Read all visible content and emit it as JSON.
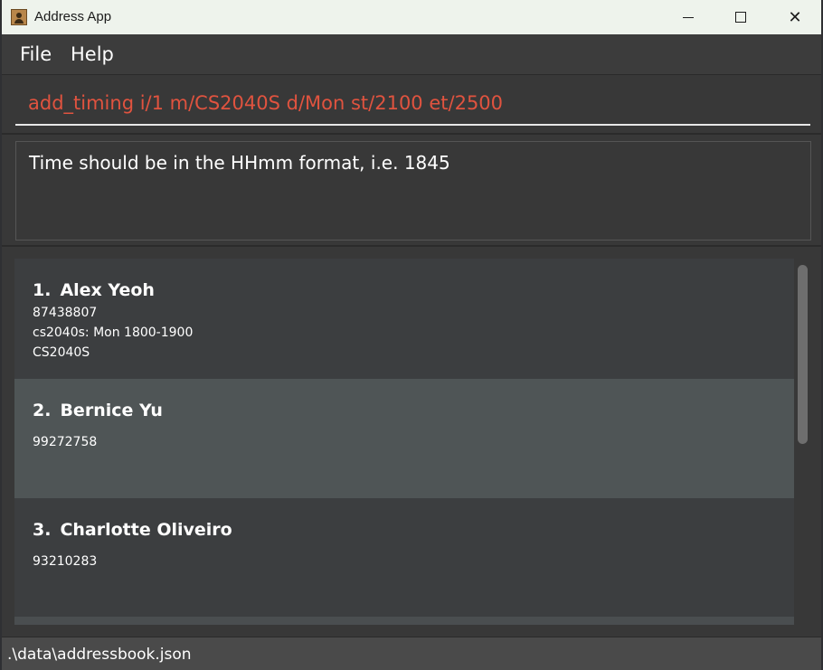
{
  "window": {
    "title": "Address App"
  },
  "menu": {
    "items": [
      "File",
      "Help"
    ]
  },
  "command": {
    "value": "add_timing i/1 m/CS2040S d/Mon st/2100 et/2500"
  },
  "result": {
    "message": "Time should be in the HHmm format, i.e. 1845"
  },
  "persons": [
    {
      "index": "1.",
      "name": "Alex Yeoh",
      "phone": "87438807",
      "timing": "cs2040s: Mon 1800-1900",
      "module": "CS2040S"
    },
    {
      "index": "2.",
      "name": "Bernice Yu",
      "phone": "99272758"
    },
    {
      "index": "3.",
      "name": "Charlotte Oliveiro",
      "phone": "93210283"
    }
  ],
  "status": {
    "path": ".\\data\\addressbook.json"
  },
  "colors": {
    "command_text": "#e0533f",
    "selected_card": "#4f5556",
    "card": "#3c3e40",
    "background": "#383838"
  },
  "icons": [
    "app-icon",
    "minimize-icon",
    "maximize-icon",
    "close-icon"
  ]
}
